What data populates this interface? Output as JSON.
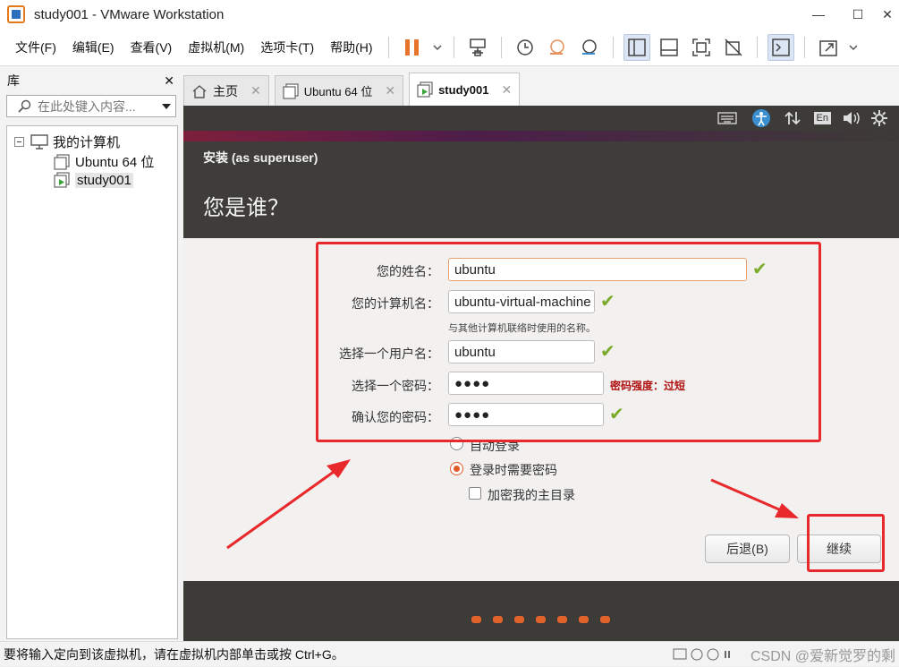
{
  "window": {
    "title": "study001 - VMware Workstation",
    "minimize": "—",
    "maximize": "☐",
    "close": "✕"
  },
  "menu": [
    "文件(F)",
    "编辑(E)",
    "查看(V)",
    "虚拟机(M)",
    "选项卡(T)",
    "帮助(H)"
  ],
  "library": {
    "title": "库",
    "close": "✕",
    "search_placeholder": "在此处键入内容...",
    "tree": {
      "root": "我的计算机",
      "items": [
        "Ubuntu 64 位",
        "study001"
      ]
    }
  },
  "tabs": [
    {
      "label": "主页"
    },
    {
      "label": "Ubuntu 64 位"
    },
    {
      "label": "study001"
    }
  ],
  "vm_topbar": {
    "lang": "En"
  },
  "installer": {
    "subtitle": "安装 (as superuser)",
    "title": "您是谁？",
    "fields": {
      "name_label": "您的姓名：",
      "name_value": "ubuntu",
      "computer_label": "您的计算机名：",
      "computer_value": "ubuntu-virtual-machine",
      "computer_hint": "与其他计算机联络时使用的名称。",
      "username_label": "选择一个用户名：",
      "username_value": "ubuntu",
      "password_label": "选择一个密码：",
      "password_value": "●●●●",
      "password_strength": "密码强度：过短",
      "confirm_label": "确认您的密码：",
      "confirm_value": "●●●●"
    },
    "options": {
      "auto_login": "自动登录",
      "require_password": "登录时需要密码",
      "encrypt_home": "加密我的主目录"
    },
    "buttons": {
      "back": "后退(B)",
      "continue": "继续"
    },
    "progress_dots": 7
  },
  "statusbar": {
    "text": "要将输入定向到该虚拟机，请在虚拟机内部单击或按 Ctrl+G。",
    "watermark": "CSDN @爱新觉罗的剩"
  },
  "colors": {
    "accent_orange": "#e05b2a",
    "annotation_red": "#e8282a",
    "check_green": "#7bab2a"
  }
}
